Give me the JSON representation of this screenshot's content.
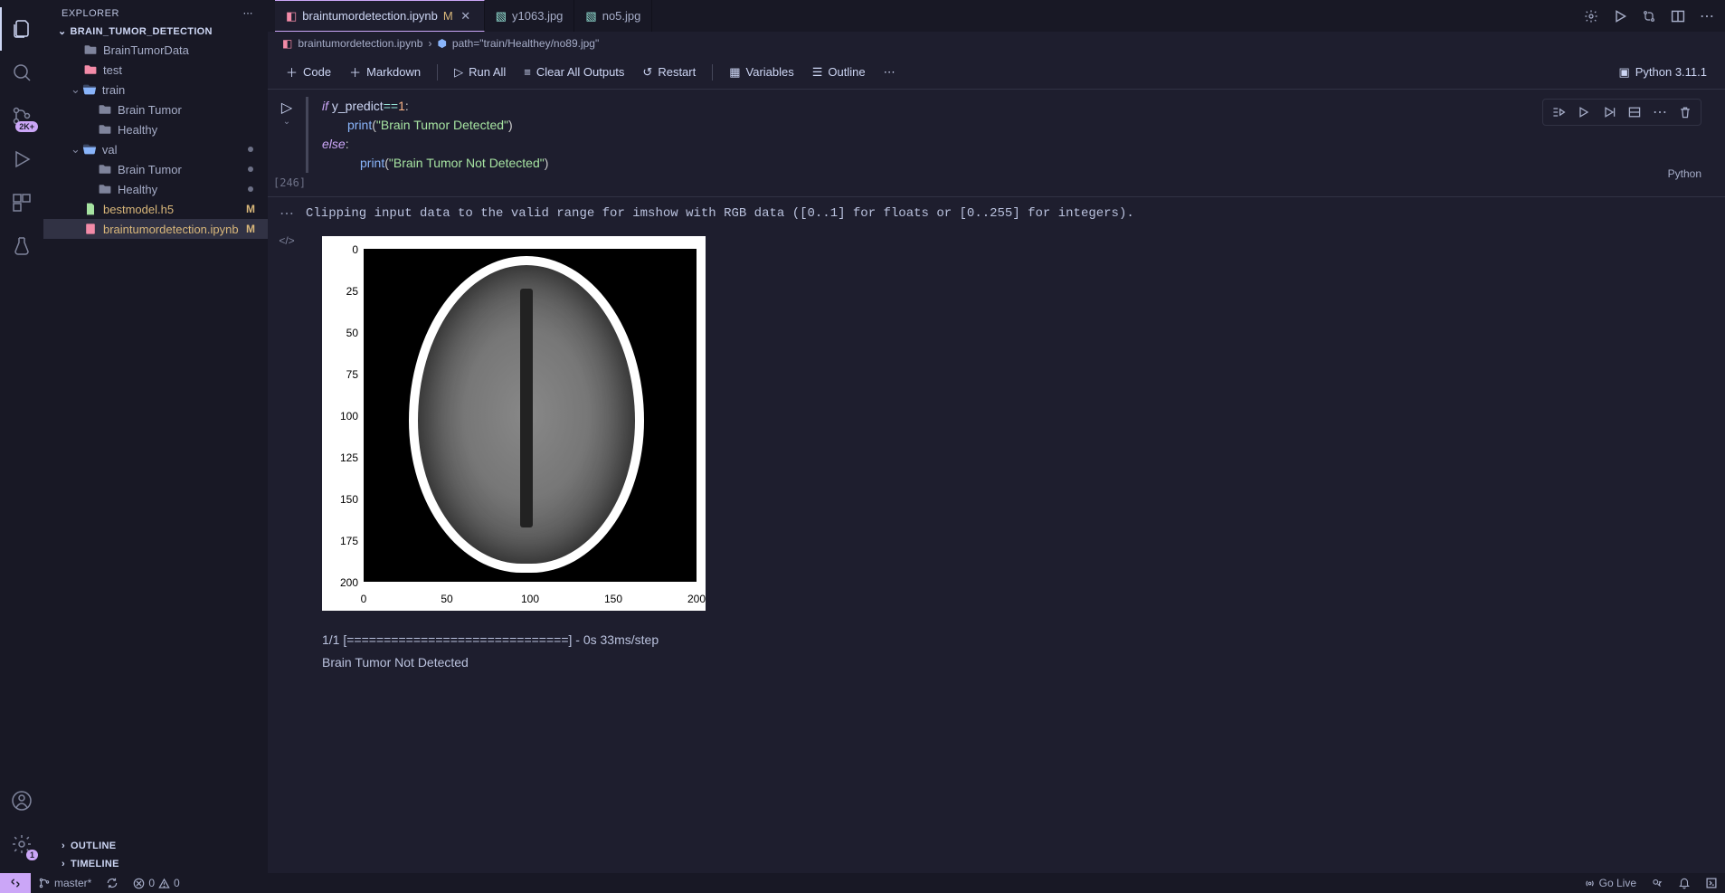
{
  "sidebar": {
    "title": "EXPLORER",
    "root": "BRAIN_TUMOR_DETECTION",
    "tree": [
      {
        "label": "BrainTumorData",
        "type": "folder",
        "depth": 2
      },
      {
        "label": "test",
        "type": "folder-red",
        "depth": 2
      },
      {
        "label": "train",
        "type": "folder-open",
        "depth": 2,
        "expanded": true
      },
      {
        "label": "Brain Tumor",
        "type": "folder",
        "depth": 3
      },
      {
        "label": "Healthy",
        "type": "folder",
        "depth": 3
      },
      {
        "label": "val",
        "type": "folder-open",
        "depth": 2,
        "expanded": true,
        "dot": true
      },
      {
        "label": "Brain Tumor",
        "type": "folder",
        "depth": 3,
        "dot": true
      },
      {
        "label": "Healthy",
        "type": "folder",
        "depth": 3,
        "dot": true
      },
      {
        "label": "bestmodel.h5",
        "type": "file-h5",
        "depth": 2,
        "mod": "M"
      },
      {
        "label": "braintumordetection.ipynb",
        "type": "file-nb",
        "depth": 2,
        "mod": "M",
        "selected": true
      }
    ],
    "sections": {
      "outline": "OUTLINE",
      "timeline": "TIMELINE"
    }
  },
  "activity": {
    "badge_git": "2K+",
    "badge_settings": "1"
  },
  "tabs": [
    {
      "label": "braintumordetection.ipynb",
      "icon": "nb",
      "active": true,
      "mod": "M",
      "close": true
    },
    {
      "label": "y1063.jpg",
      "icon": "img",
      "active": false
    },
    {
      "label": "no5.jpg",
      "icon": "img",
      "active": false
    }
  ],
  "breadcrumb": {
    "file": "braintumordetection.ipynb",
    "symbol": "path=\"train/Healthey/no89.jpg\""
  },
  "toolbar": {
    "code": "Code",
    "markdown": "Markdown",
    "runall": "Run All",
    "clear": "Clear All Outputs",
    "restart": "Restart",
    "variables": "Variables",
    "outline": "Outline",
    "kernel": "Python 3.11.1"
  },
  "cell": {
    "exec_count": "[246]",
    "lang": "Python",
    "code": {
      "l1_if": "if",
      "l1_var": " y_predict",
      "l1_op": "==",
      "l1_num": "1",
      "l1_colon": ":",
      "l2_func": "print",
      "l2_paren_o": "(",
      "l2_str": "\"Brain Tumor Detected\"",
      "l2_paren_c": ")",
      "l3_else": "else",
      "l3_colon": ":",
      "l4_func": "print",
      "l4_paren_o": "(",
      "l4_str": "\"Brain Tumor Not Detected\"",
      "l4_paren_c": ")"
    },
    "output_warning": "Clipping input data to the valid range for imshow with RGB data ([0..1] for floats or [0..255] for integers).",
    "output_progress": "1/1 [==============================] - 0s 33ms/step",
    "output_result": "Brain Tumor Not Detected"
  },
  "chart_data": {
    "type": "image-plot",
    "y_ticks": [
      "0",
      "25",
      "50",
      "75",
      "100",
      "125",
      "150",
      "175",
      "200"
    ],
    "x_ticks": [
      "0",
      "50",
      "100",
      "150",
      "200"
    ],
    "ylim": [
      0,
      200
    ],
    "xlim": [
      0,
      200
    ],
    "image_desc": "grayscale brain MRI axial slice"
  },
  "statusbar": {
    "branch": "master*",
    "errors": "0",
    "warnings": "0",
    "golive": "Go Live"
  }
}
